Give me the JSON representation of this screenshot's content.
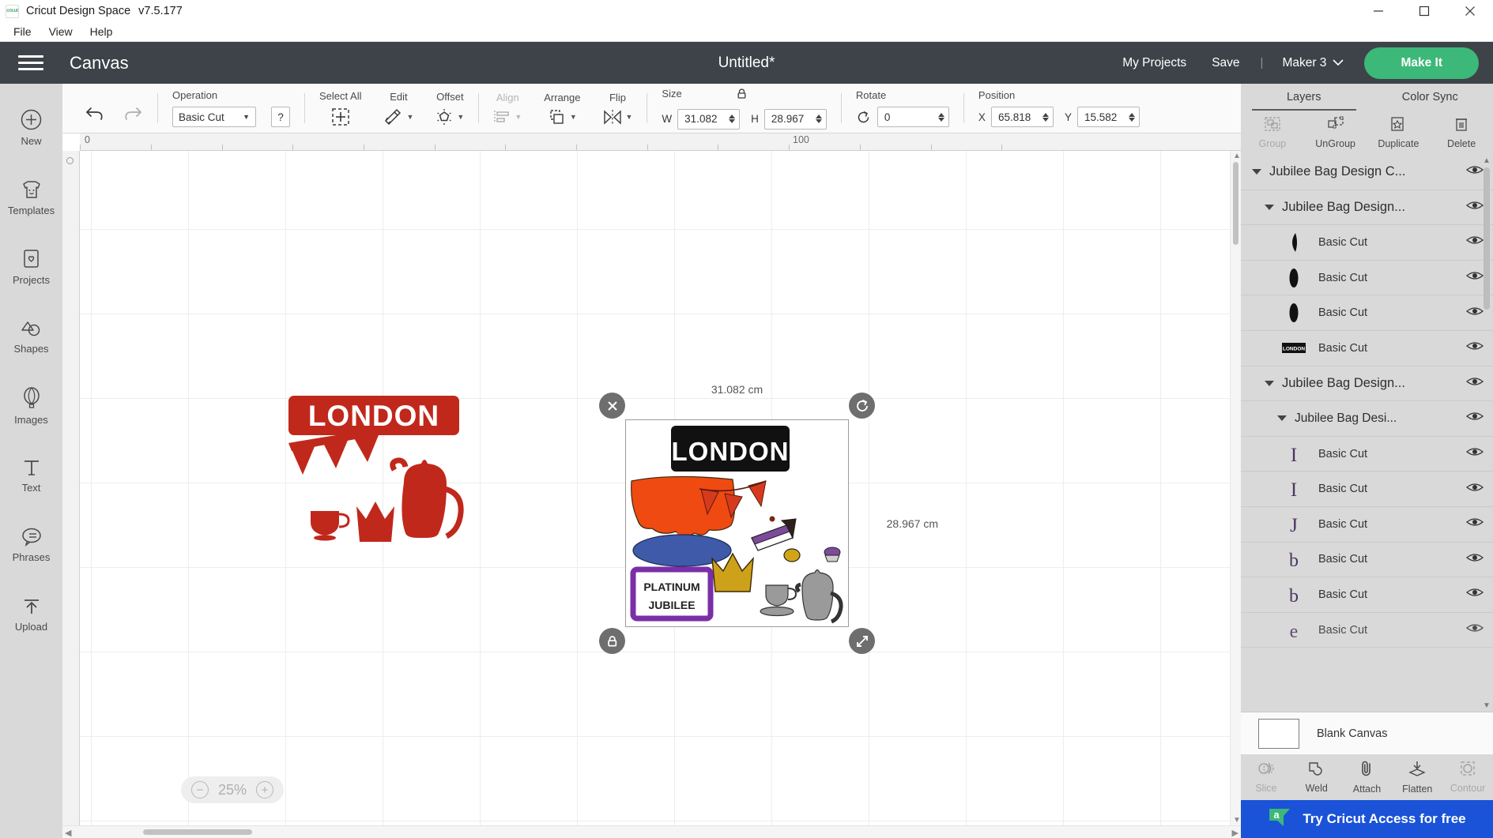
{
  "window": {
    "app_name": "Cricut Design Space",
    "version": "v7.5.177",
    "icon": "cricut-logo-icon",
    "controls": {
      "minimize": "minimize-icon",
      "maximize": "maximize-icon",
      "close": "close-icon"
    }
  },
  "menubar": {
    "items": [
      {
        "label": "File"
      },
      {
        "label": "View"
      },
      {
        "label": "Help"
      }
    ]
  },
  "header": {
    "menu_icon": "hamburger-menu-icon",
    "canvas_label": "Canvas",
    "document_title": "Untitled*",
    "my_projects": "My Projects",
    "save": "Save",
    "separator": "|",
    "machine": "Maker 3",
    "make_it": "Make It",
    "accent_green": "#3cb878",
    "header_bg": "#3d4349"
  },
  "sidebar": {
    "items": [
      {
        "label": "New",
        "icon": "plus-circle-icon"
      },
      {
        "label": "Templates",
        "icon": "tshirt-icon"
      },
      {
        "label": "Projects",
        "icon": "card-heart-icon"
      },
      {
        "label": "Shapes",
        "icon": "shapes-icon"
      },
      {
        "label": "Images",
        "icon": "hot-air-balloon-icon"
      },
      {
        "label": "Text",
        "icon": "text-t-icon"
      },
      {
        "label": "Phrases",
        "icon": "speech-bubble-icon"
      },
      {
        "label": "Upload",
        "icon": "upload-arrow-icon"
      }
    ]
  },
  "toolbar": {
    "undo": "undo-icon",
    "redo": "redo-icon",
    "operation": {
      "caption": "Operation",
      "value": "Basic Cut",
      "help": "?"
    },
    "select_all": {
      "caption": "Select All",
      "icon": "select-all-icon"
    },
    "edit": {
      "caption": "Edit",
      "icon": "edit-pencil-icon"
    },
    "offset": {
      "caption": "Offset",
      "icon": "offset-icon"
    },
    "align": {
      "caption": "Align",
      "icon": "align-icon",
      "disabled": true
    },
    "arrange": {
      "caption": "Arrange",
      "icon": "arrange-icon"
    },
    "flip": {
      "caption": "Flip",
      "icon": "flip-icon"
    },
    "size": {
      "caption": "Size",
      "lock_icon": "lock-closed-icon",
      "w_label": "W",
      "w_value": "31.082",
      "h_label": "H",
      "h_value": "28.967"
    },
    "rotate": {
      "caption": "Rotate",
      "icon": "rotate-icon",
      "value": "0"
    },
    "position": {
      "caption": "Position",
      "x_label": "X",
      "x_value": "65.818",
      "y_label": "Y",
      "y_value": "15.582"
    }
  },
  "canvas": {
    "ruler": {
      "ticks": [
        "0",
        "100"
      ]
    },
    "zoom": {
      "minus": "−",
      "value": "25%",
      "plus": "+"
    },
    "selection": {
      "width_label": "31.082 cm",
      "height_label": "28.967 cm",
      "delete_handle": "delete-selection-icon",
      "rotate_handle": "rotate-selection-icon",
      "lock_handle": "lock-aspect-icon",
      "resize_handle": "resize-selection-icon"
    },
    "artwork": {
      "left_design": {
        "name": "london-tea-party-red",
        "sign_text": "LONDON",
        "color": "#c0281c"
      },
      "selected_design": {
        "name": "jubilee-bag-design",
        "sign_text": "LONDON",
        "plaque_line1": "PLATINUM",
        "plaque_line2": "JUBILEE",
        "colors": {
          "sign": "#111111",
          "cake": "#ef4a11",
          "plate": "#3f5aa8",
          "crown": "#ceа11b",
          "plaque": "#7a2fa8",
          "teapot": "#9a9a9a",
          "bunting": "#d63a1e"
        }
      }
    }
  },
  "right_panel": {
    "tabs": [
      {
        "label": "Layers",
        "active": true
      },
      {
        "label": "Color Sync",
        "active": false
      }
    ],
    "actions": [
      {
        "label": "Group",
        "icon": "group-icon",
        "disabled": true
      },
      {
        "label": "UnGroup",
        "icon": "ungroup-icon",
        "disabled": false
      },
      {
        "label": "Duplicate",
        "icon": "duplicate-icon",
        "disabled": false
      },
      {
        "label": "Delete",
        "icon": "trash-icon",
        "disabled": false
      }
    ],
    "layers": [
      {
        "type": "group",
        "indent": 1,
        "name": "Jubilee Bag Design C...",
        "eye": "eye-icon"
      },
      {
        "type": "group",
        "indent": 2,
        "name": "Jubilee Bag Design...",
        "eye": "eye-icon"
      },
      {
        "type": "leaf",
        "indent": 3,
        "name": "Basic Cut",
        "thumb": "half-ellipse-black",
        "eye": "eye-icon"
      },
      {
        "type": "leaf",
        "indent": 3,
        "name": "Basic Cut",
        "thumb": "ellipse-black",
        "eye": "eye-icon"
      },
      {
        "type": "leaf",
        "indent": 3,
        "name": "Basic Cut",
        "thumb": "ellipse-black",
        "eye": "eye-icon"
      },
      {
        "type": "leaf",
        "indent": 3,
        "name": "Basic Cut",
        "thumb": "london-sign-black",
        "eye": "eye-icon"
      },
      {
        "type": "group",
        "indent": 2,
        "name": "Jubilee Bag Design...",
        "eye": "eye-icon"
      },
      {
        "type": "group",
        "indent": 3,
        "name": "Jubilee Bag Desi...",
        "eye": "eye-icon"
      },
      {
        "type": "leaf",
        "indent": 4,
        "name": "Basic Cut",
        "thumb": "letter-I-purple",
        "eye": "eye-icon"
      },
      {
        "type": "leaf",
        "indent": 4,
        "name": "Basic Cut",
        "thumb": "letter-I-purple",
        "eye": "eye-icon"
      },
      {
        "type": "leaf",
        "indent": 4,
        "name": "Basic Cut",
        "thumb": "letter-J-purple",
        "eye": "eye-icon"
      },
      {
        "type": "leaf",
        "indent": 4,
        "name": "Basic Cut",
        "thumb": "letter-b-purple",
        "eye": "eye-icon"
      },
      {
        "type": "leaf",
        "indent": 4,
        "name": "Basic Cut",
        "thumb": "letter-b-purple",
        "eye": "eye-icon"
      },
      {
        "type": "leaf",
        "indent": 4,
        "name": "Basic Cut",
        "thumb": "letter-e-purple",
        "eye": "eye-icon"
      }
    ],
    "canvas_row": {
      "label": "Blank Canvas",
      "swatch_color": "#ffffff"
    },
    "bottom_tools": [
      {
        "label": "Slice",
        "icon": "slice-icon",
        "disabled": true
      },
      {
        "label": "Weld",
        "icon": "weld-icon",
        "disabled": false
      },
      {
        "label": "Attach",
        "icon": "paperclip-icon",
        "disabled": false
      },
      {
        "label": "Flatten",
        "icon": "flatten-icon",
        "disabled": false
      },
      {
        "label": "Contour",
        "icon": "contour-icon",
        "disabled": true
      }
    ],
    "promo": {
      "text": "Try Cricut Access for free",
      "logo": "cricut-access-a-icon",
      "bg": "#1a53d8"
    }
  }
}
